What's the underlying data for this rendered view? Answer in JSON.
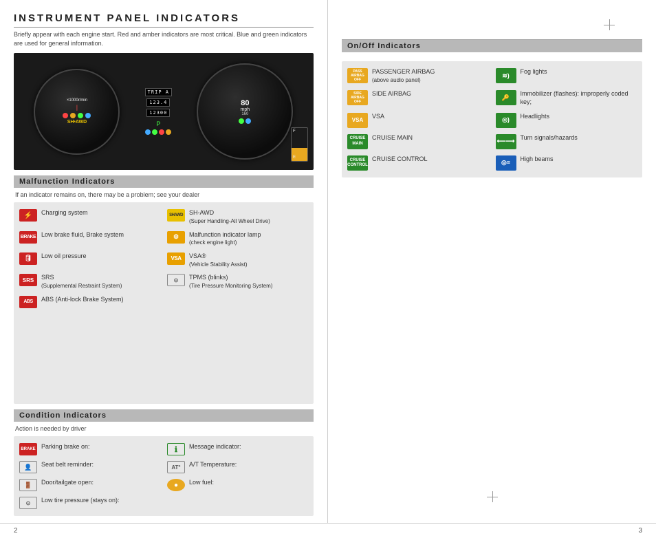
{
  "page": {
    "title": "INSTRUMENT PANEL INDICATORS",
    "subtitle": "Briefly appear with each engine start. Red and amber indicators are most critical. Blue and green indicators are used for general information.",
    "page_left_number": "2",
    "page_right_number": "3"
  },
  "dashboard": {
    "odometer_trip": "TRIP A",
    "odometer_value": "123.4",
    "odometer_total": "12300",
    "tach_label": "×1000r/min",
    "speed_label": "mph",
    "speed_max": "160"
  },
  "malfunction": {
    "header": "Malfunction Indicators",
    "subtext": "If an indicator remains on, there may be a problem; see your dealer",
    "items": [
      {
        "icon_text": "⚡",
        "icon_class": "icon-charging",
        "label": "Charging system"
      },
      {
        "icon_text": "SHAWD",
        "icon_class": "icon-shawd",
        "label": "SH-AWD (Super Handling-All Wheel Drive)"
      },
      {
        "icon_text": "BRAKE",
        "icon_class": "icon-brake-text",
        "label": "Low brake fluid, Brake system"
      },
      {
        "icon_text": "⚙",
        "icon_class": "icon-engine",
        "label": "Malfunction indicator lamp (check engine light)"
      },
      {
        "icon_text": "🛢",
        "icon_class": "icon-oil",
        "label": "Low oil pressure"
      },
      {
        "icon_text": "VSA",
        "icon_class": "icon-vsa-text",
        "label": "VSA® (Vehicle Stability Assist)"
      },
      {
        "icon_text": "SRS",
        "icon_class": "icon-srs",
        "label": "SRS (Supplemental Restraint System)"
      },
      {
        "icon_text": "⊙",
        "icon_class": "icon-tpms",
        "label": "TPMS (blinks) (Tire Pressure Monitoring System)"
      },
      {
        "icon_text": "ABS",
        "icon_class": "icon-abs",
        "label": "ABS (Anti-lock Brake System)"
      }
    ]
  },
  "condition": {
    "header": "Condition Indicators",
    "subtext": "Action is needed by driver",
    "items": [
      {
        "icon_text": "BRAKE",
        "icon_class": "icon-park-brake",
        "label": "Parking brake on:"
      },
      {
        "icon_text": "ℹ",
        "icon_class": "icon-message",
        "label": "Message indicator:"
      },
      {
        "icon_text": "🔔",
        "icon_class": "icon-seatbelt",
        "label": "Seat belt reminder:"
      },
      {
        "icon_text": "⚙",
        "icon_class": "icon-at-temp",
        "label": "A/T Temperature:"
      },
      {
        "icon_text": "🚪",
        "icon_class": "icon-door",
        "label": "Door/tailgate open:"
      },
      {
        "icon_text": "●",
        "icon_class": "icon-low-fuel-circle",
        "label": "Low fuel:"
      },
      {
        "icon_text": "⊙",
        "icon_class": "icon-low-tire",
        "label": "Low tire pressure (stays on):"
      }
    ]
  },
  "onoff": {
    "header": "On/Off Indicators",
    "items": [
      {
        "icon_text": "PASS\nAIRBAG\nOFF",
        "icon_class": "icon-passenger-airbag",
        "label": "PASSENGER AIRBAG (above audio panel)"
      },
      {
        "icon_text": "))))",
        "icon_class": "icon-fog",
        "label": "Fog lights"
      },
      {
        "icon_text": "SIDE\nAIRBAG\nOFF",
        "icon_class": "icon-side-airbag",
        "label": "SIDE AIRBAG"
      },
      {
        "icon_text": "🔑",
        "icon_class": "icon-immobilizer",
        "label": "Immobilizer (flashes): improperly coded key;"
      },
      {
        "icon_text": "VSA",
        "icon_class": "icon-vsa-on",
        "label": "VSA"
      },
      {
        "icon_text": "◎",
        "icon_class": "icon-headlights",
        "label": "Headlights"
      },
      {
        "icon_text": "CR\nMAIN",
        "icon_class": "icon-cruise-main",
        "label": "CRUISE MAIN"
      },
      {
        "icon_text": "⟺",
        "icon_class": "icon-turn",
        "label": "Turn signals/hazards"
      },
      {
        "icon_text": "CRUISE\nCTRL",
        "icon_class": "icon-cruise-control",
        "label": "CRUISE CONTROL"
      },
      {
        "icon_text": "◎",
        "icon_class": "icon-highbeam",
        "label": "High beams"
      }
    ]
  }
}
